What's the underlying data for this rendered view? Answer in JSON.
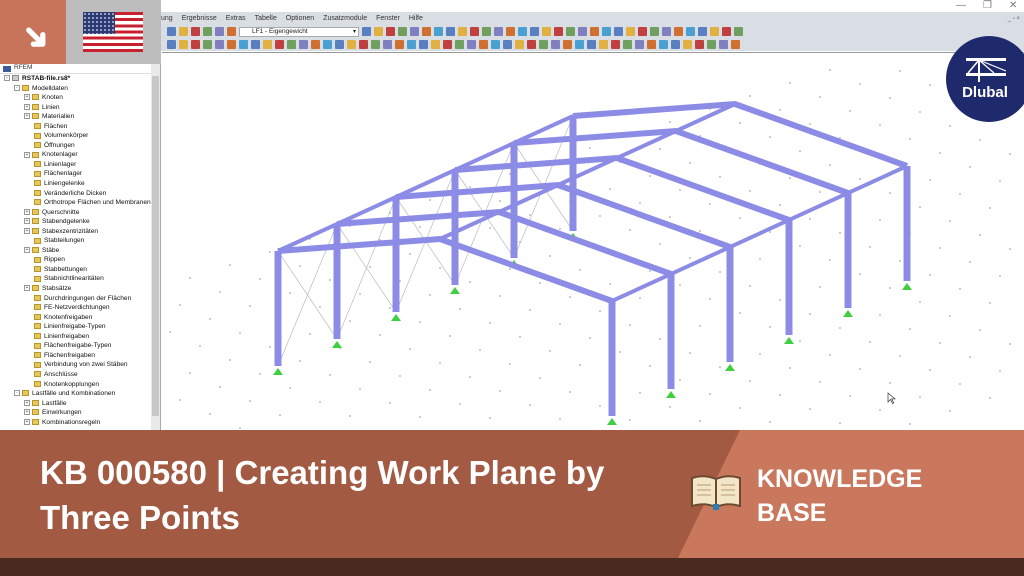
{
  "window": {
    "minimize": "—",
    "restore": "❐",
    "close": "✕",
    "sub_controls": "_ ▫ ×"
  },
  "menu": [
    "ung",
    "Ergebnisse",
    "Extras",
    "Tabelle",
    "Optionen",
    "Zusatzmodule",
    "Fenster",
    "Hilfe"
  ],
  "toolbar": {
    "loadcase": "LF1 - Eigengewicht"
  },
  "navigator": {
    "root": "RFEM",
    "file": "RSTAB-file.rs8*",
    "items": [
      {
        "label": "Modelldaten",
        "level": 1,
        "exp": "-"
      },
      {
        "label": "Knoten",
        "level": 2,
        "exp": "+"
      },
      {
        "label": "Linien",
        "level": 2,
        "exp": "+"
      },
      {
        "label": "Materialien",
        "level": 2,
        "exp": "+"
      },
      {
        "label": "Flächen",
        "level": 2,
        "exp": ""
      },
      {
        "label": "Volumenkörper",
        "level": 2,
        "exp": ""
      },
      {
        "label": "Öffnungen",
        "level": 2,
        "exp": ""
      },
      {
        "label": "Knotenlager",
        "level": 2,
        "exp": "+"
      },
      {
        "label": "Linienlager",
        "level": 2,
        "exp": ""
      },
      {
        "label": "Flächenlager",
        "level": 2,
        "exp": ""
      },
      {
        "label": "Liniengelenke",
        "level": 2,
        "exp": ""
      },
      {
        "label": "Veränderliche Dicken",
        "level": 2,
        "exp": ""
      },
      {
        "label": "Orthotrope Flächen und Membranen",
        "level": 2,
        "exp": ""
      },
      {
        "label": "Querschnitte",
        "level": 2,
        "exp": "+"
      },
      {
        "label": "Stabendgelenke",
        "level": 2,
        "exp": "+"
      },
      {
        "label": "Stabexzentrizitäten",
        "level": 2,
        "exp": "+"
      },
      {
        "label": "Stabteilungen",
        "level": 2,
        "exp": ""
      },
      {
        "label": "Stäbe",
        "level": 2,
        "exp": "+"
      },
      {
        "label": "Rippen",
        "level": 2,
        "exp": ""
      },
      {
        "label": "Stabbettungen",
        "level": 2,
        "exp": ""
      },
      {
        "label": "Stabnichtlinearitäten",
        "level": 2,
        "exp": ""
      },
      {
        "label": "Stabsätze",
        "level": 2,
        "exp": "+"
      },
      {
        "label": "Durchdringungen der Flächen",
        "level": 2,
        "exp": ""
      },
      {
        "label": "FE-Netzverdichtungen",
        "level": 2,
        "exp": ""
      },
      {
        "label": "Knotenfreigaben",
        "level": 2,
        "exp": ""
      },
      {
        "label": "Linienfreigabe-Typen",
        "level": 2,
        "exp": ""
      },
      {
        "label": "Linienfreigaben",
        "level": 2,
        "exp": ""
      },
      {
        "label": "Flächenfreigabe-Typen",
        "level": 2,
        "exp": ""
      },
      {
        "label": "Flächenfreigaben",
        "level": 2,
        "exp": ""
      },
      {
        "label": "Verbindung von zwei Stäben",
        "level": 2,
        "exp": ""
      },
      {
        "label": "Anschlüsse",
        "level": 2,
        "exp": ""
      },
      {
        "label": "Knotenkopplungen",
        "level": 2,
        "exp": ""
      },
      {
        "label": "Lastfälle und Kombinationen",
        "level": 1,
        "exp": "-"
      },
      {
        "label": "Lastfälle",
        "level": 2,
        "exp": "+"
      },
      {
        "label": "Einwirkungen",
        "level": 2,
        "exp": "+"
      },
      {
        "label": "Kombinationsregeln",
        "level": 2,
        "exp": "+"
      }
    ]
  },
  "logo": {
    "text": "Dlubal"
  },
  "banner": {
    "title": "KB 000580 | Creating Work Plane by Three Points",
    "kb_line1": "KNOWLEDGE",
    "kb_line2": "BASE"
  },
  "colors": {
    "beam": "#8c8ce6",
    "support": "#3fcf3f",
    "banner_dark": "#a35a43",
    "banner_light": "#c9785d",
    "dlubal": "#1e2a6b"
  }
}
